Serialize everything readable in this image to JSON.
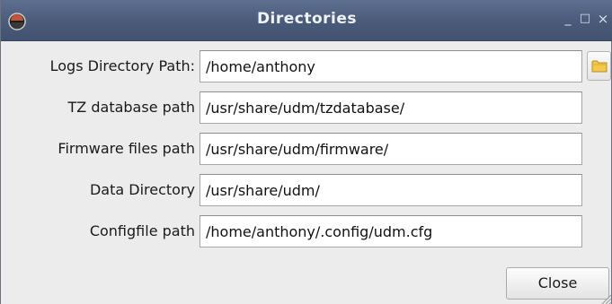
{
  "window": {
    "title": "Directories",
    "controls": {
      "minimize": "_",
      "maximize": "□",
      "close": "×"
    }
  },
  "fields": [
    {
      "label": "Logs Directory Path:",
      "value": "/home/anthony"
    },
    {
      "label": "TZ database path",
      "value": "/usr/share/udm/tzdatabase/"
    },
    {
      "label": "Firmware files path",
      "value": "/usr/share/udm/firmware/"
    },
    {
      "label": "Data Directory",
      "value": "/usr/share/udm/"
    },
    {
      "label": "Configfile path",
      "value": "/home/anthony/.config/udm.cfg"
    }
  ],
  "icons": {
    "app": "app-logo-icon",
    "browse": "folder-icon"
  },
  "buttons": {
    "close_label": "Close"
  },
  "colors": {
    "titlebar": "#4a5a79",
    "title_text": "#eef2fa",
    "window_bg": "#ececec",
    "folder": "#f2c94c"
  }
}
